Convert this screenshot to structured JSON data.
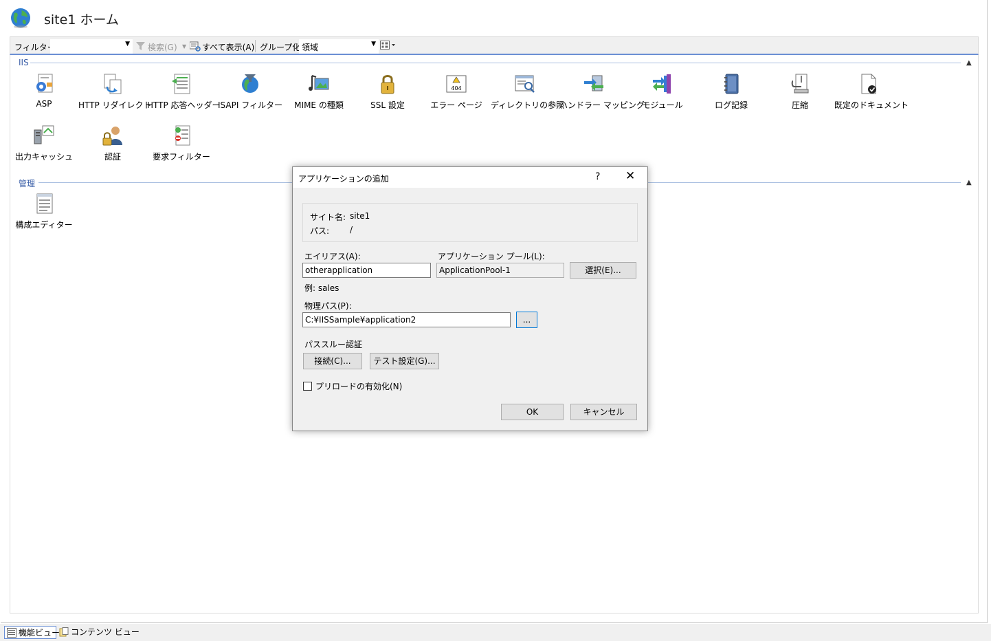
{
  "header": {
    "title": "site1 ホーム"
  },
  "toolbar": {
    "filter_label": "フィルター:",
    "filter_value": "",
    "search_label": "検索(G)",
    "show_all_label": "すべて表示(A)",
    "group_label": "グループ化:",
    "group_value": "領域"
  },
  "groups": {
    "iis": {
      "title": "IIS"
    },
    "management": {
      "title": "管理"
    }
  },
  "features": {
    "asp": "ASP",
    "http_redirect": "HTTP リダイレクト",
    "http_headers": "HTTP 応答ヘッダー",
    "isapi_filters": "ISAPI フィルター",
    "mime_types": "MIME の種類",
    "ssl": "SSL 設定",
    "error_pages": "エラー ページ",
    "dir_browsing": "ディレクトリの参照",
    "handler_mappings": "ハンドラー マッピング",
    "modules": "モジュール",
    "logging": "ログ記録",
    "compression": "圧縮",
    "default_document": "既定のドキュメント",
    "output_cache": "出力キャッシュ",
    "authentication": "認証",
    "request_filtering": "要求フィルター",
    "config_editor": "構成エディター"
  },
  "dialog": {
    "title": "アプリケーションの追加",
    "help": "?",
    "close": "✕",
    "site_name_label": "サイト名:",
    "site_name_value": "site1",
    "path_label": "パス:",
    "path_value": "/",
    "alias_label": "エイリアス(A):",
    "alias_value": "otherapplication",
    "alias_example": "例: sales",
    "app_pool_label": "アプリケーション プール(L):",
    "app_pool_value": "ApplicationPool-1",
    "select_button": "選択(E)...",
    "physical_path_label": "物理パス(P):",
    "physical_path_value": "C:¥IISSample¥application2",
    "browse_button": "...",
    "passthrough_label": "パススルー認証",
    "connect_button": "接続(C)...",
    "test_button": "テスト設定(G)...",
    "preload_label": "プリロードの有効化(N)",
    "preload_checked": false,
    "ok_button": "OK",
    "cancel_button": "キャンセル"
  },
  "bottom_tabs": {
    "features_view": "機能ビュー",
    "content_view": "コンテンツ ビュー"
  },
  "colors": {
    "accent": "#0078d7",
    "group_title": "#3b5fa8"
  }
}
